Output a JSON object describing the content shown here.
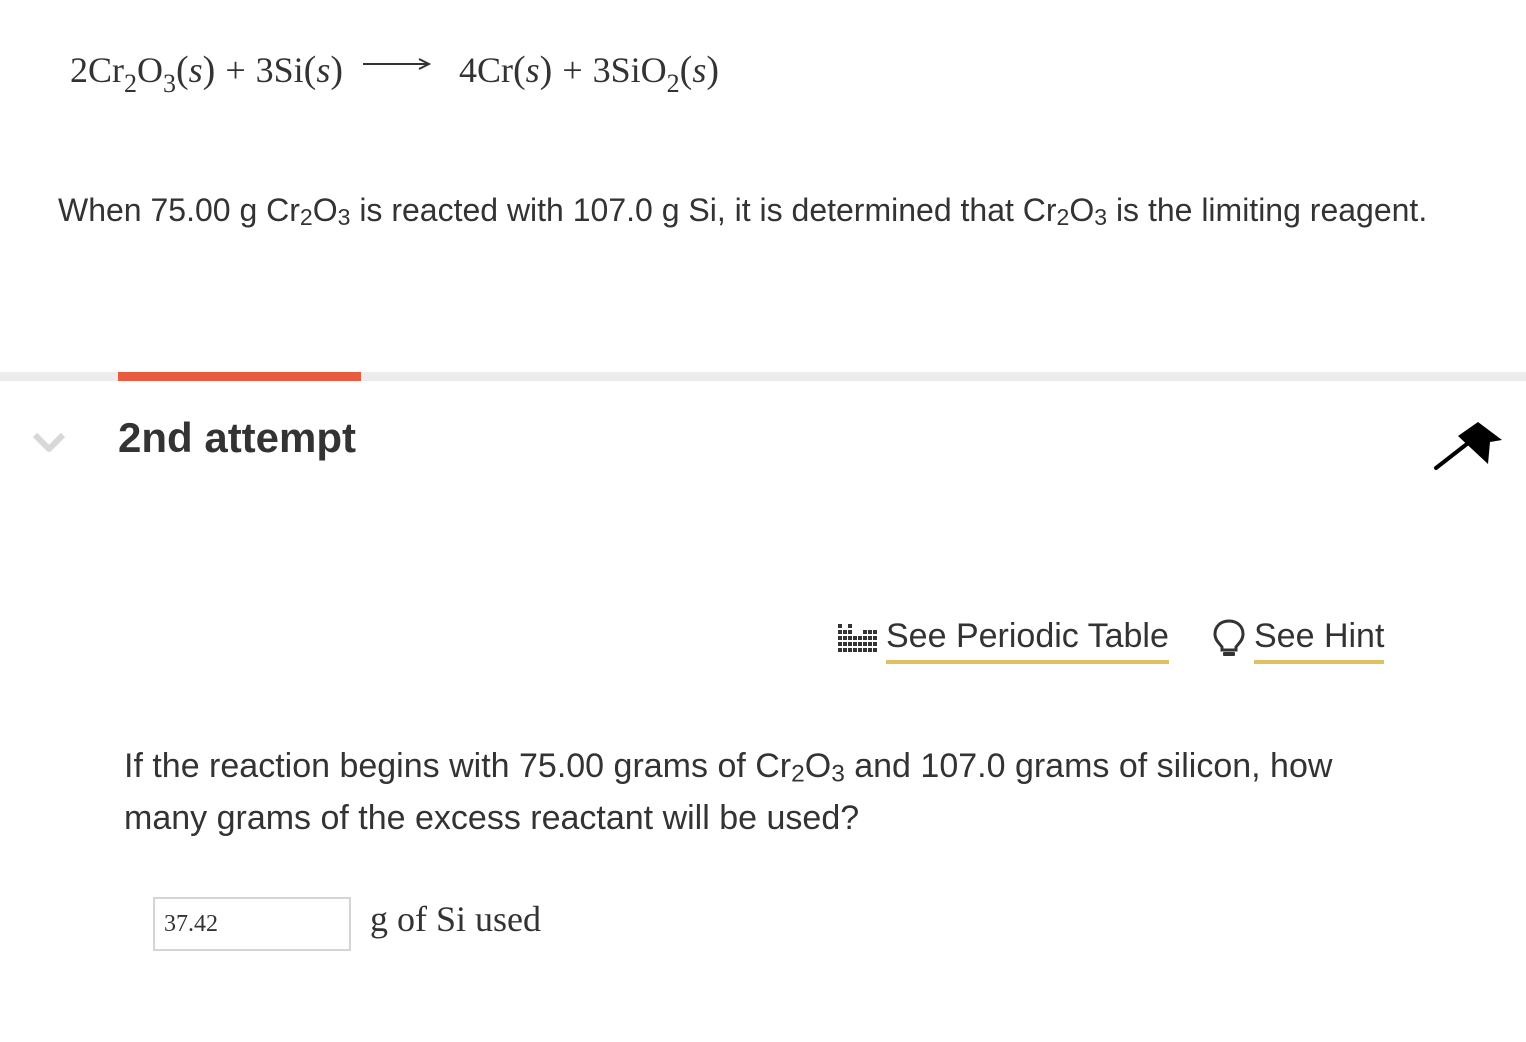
{
  "equation": {
    "reactant1_coef": "2Cr",
    "reactant1_sub1": "2",
    "reactant1_o": "O",
    "reactant1_sub2": "3",
    "reactant1_state": "s",
    "plus1": "+",
    "reactant2": "3Si",
    "reactant2_state": "s",
    "product1": "4Cr",
    "product1_state": "s",
    "plus2": "+",
    "product2": "3SiO",
    "product2_sub": "2",
    "product2_state": "s"
  },
  "statement": {
    "part1": "When 75.00  g Cr",
    "sub1": "2",
    "part2": "O",
    "sub2": "3",
    "part3": " is reacted with 107.0  g Si, it is determined that Cr",
    "sub3": "2",
    "part4": "O",
    "sub4": "3",
    "part5": " is the limiting reagent."
  },
  "attempt": {
    "title": "2nd attempt"
  },
  "tools": {
    "periodic_table_label": "See Periodic Table",
    "hint_label": "See Hint"
  },
  "question": {
    "part1": "If the reaction begins with 75.00 grams of Cr",
    "sub1": "2",
    "part2": "O",
    "sub2": "3",
    "part3": " and 107.0 grams of silicon, how many grams of the excess reactant will be used?"
  },
  "answer": {
    "value": "37.42",
    "unit": "g of Si used"
  },
  "colors": {
    "accent": "#ea5a3e",
    "link_underline": "#e0c060",
    "text": "#333333"
  }
}
